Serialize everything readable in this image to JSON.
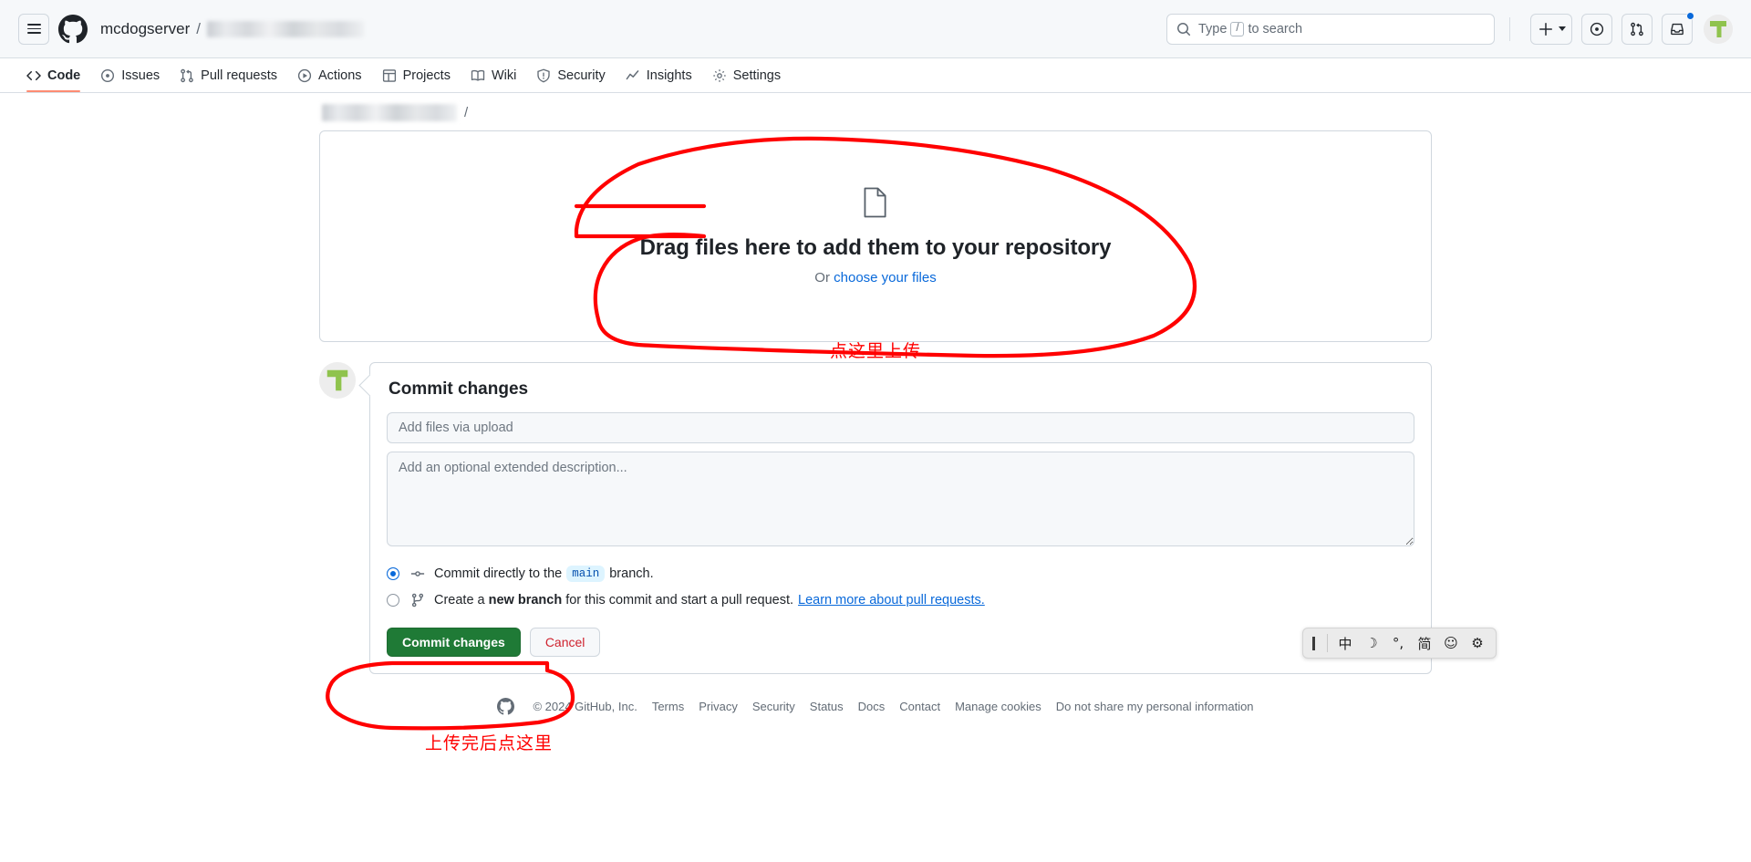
{
  "header": {
    "menu_icon": "hamburger-icon",
    "logo_icon": "github-mark-icon",
    "owner": "mcdogserver",
    "separator": "/",
    "repo_redacted": true,
    "search": {
      "placeholder_prefix": "Type",
      "key": "/",
      "placeholder_suffix": "to search",
      "icon": "search-icon"
    },
    "actions": [
      {
        "name": "create-new-menu",
        "icon": "plus-icon",
        "has_caret": true
      },
      {
        "name": "issues-button",
        "icon": "issue-opened-icon"
      },
      {
        "name": "pull-requests-button",
        "icon": "git-pull-request-icon"
      },
      {
        "name": "notifications-button",
        "icon": "inbox-icon",
        "unread": true
      },
      {
        "name": "user-avatar",
        "icon": "avatar-icon"
      }
    ]
  },
  "repo_nav": {
    "tabs": [
      {
        "label": "Code",
        "icon": "code-icon",
        "selected": true
      },
      {
        "label": "Issues",
        "icon": "issue-opened-icon",
        "selected": false
      },
      {
        "label": "Pull requests",
        "icon": "git-pull-request-icon",
        "selected": false
      },
      {
        "label": "Actions",
        "icon": "play-icon",
        "selected": false
      },
      {
        "label": "Projects",
        "icon": "table-icon",
        "selected": false
      },
      {
        "label": "Wiki",
        "icon": "book-icon",
        "selected": false
      },
      {
        "label": "Security",
        "icon": "shield-icon",
        "selected": false
      },
      {
        "label": "Insights",
        "icon": "graph-icon",
        "selected": false
      },
      {
        "label": "Settings",
        "icon": "gear-icon",
        "selected": false
      }
    ]
  },
  "breadcrumb": {
    "repo_redacted": true,
    "trailing_separator": "/"
  },
  "dropzone": {
    "icon": "file-icon",
    "title": "Drag files here to add them to your repository",
    "or_text": "Or ",
    "choose_link": "choose your files"
  },
  "commit": {
    "avatar_icon": "avatar-icon",
    "heading": "Commit changes",
    "message_placeholder": "Add files via upload",
    "message_value": "",
    "description_placeholder": "Add an optional extended description...",
    "description_value": "",
    "options": [
      {
        "selected": true,
        "icon": "git-commit-icon",
        "text_before": "Commit directly to the",
        "branch": "main",
        "text_after": "branch."
      },
      {
        "selected": false,
        "icon": "git-branch-icon",
        "text_before": "Create a",
        "strong": "new branch",
        "text_after": "for this commit and start a pull request.",
        "link": "Learn more about pull requests."
      }
    ],
    "submit_label": "Commit changes",
    "cancel_label": "Cancel"
  },
  "footer": {
    "logo_icon": "github-mark-icon",
    "copyright": "© 2024 GitHub, Inc.",
    "links": [
      "Terms",
      "Privacy",
      "Security",
      "Status",
      "Docs",
      "Contact",
      "Manage cookies",
      "Do not share my personal information"
    ]
  },
  "annotations": {
    "color": "#ff0000",
    "dropzone_note": "点这里上传",
    "commit_note": "上传完后点这里"
  },
  "ime_bar": {
    "items": [
      {
        "name": "ime-caret",
        "glyph": ""
      },
      {
        "name": "ime-language-chinese",
        "glyph": "中"
      },
      {
        "name": "ime-mode-moon",
        "glyph": "☽"
      },
      {
        "name": "ime-punctuation",
        "glyph": "°,"
      },
      {
        "name": "ime-simplified",
        "glyph": "简"
      },
      {
        "name": "ime-emoji",
        "glyph": "☺"
      },
      {
        "name": "ime-settings",
        "glyph": "⚙"
      }
    ]
  },
  "colors": {
    "accent_blue": "#0969da",
    "green_button": "#1f7a36",
    "danger_red": "#cf222e",
    "tab_underline": "#fd8c73",
    "annotation_red": "#ff0000"
  }
}
